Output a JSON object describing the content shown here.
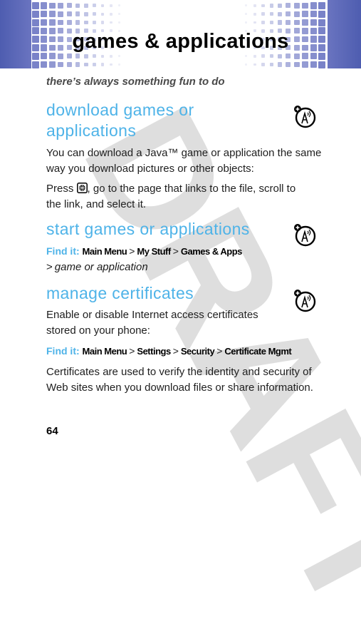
{
  "header": {
    "title": "games & applications"
  },
  "tagline": "there’s always something fun to do",
  "watermark": "DRAFT",
  "sections": [
    {
      "title_line1": "download games or",
      "title_line2": "applications",
      "icon": "network-feature-icon",
      "paragraph1": "You can download a Java™ game or application the same way you download pictures or other objects:",
      "paragraph1_line1": "You can download a Java™ game or application the same",
      "paragraph1_line2": "way you download pictures or other objects:",
      "press_prefix": "Press",
      "press_key_icon": "browser-key-icon",
      "press_line1_rest": ", go to the page that links to the file, scroll to",
      "press_line2": "the link, and select it."
    },
    {
      "title": "start games or applications",
      "icon": "network-feature-icon",
      "find_it_label": "Find it:",
      "path": [
        "Main Menu",
        "My Stuff",
        "Games & Apps"
      ],
      "path_tail": "game or application",
      "separator": ">"
    },
    {
      "title": "manage certificates",
      "icon": "network-feature-icon",
      "paragraph_line1": "Enable or disable Internet access certificates",
      "paragraph_line2": "stored on your phone:",
      "find_it_label": "Find it:",
      "path": [
        "Main Menu",
        "Settings",
        "Security",
        "Certificate Mgmt"
      ],
      "separator": ">",
      "note_line1": "Certificates are used to verify the identity and security of",
      "note_line2": "Web sites when you download files or share information."
    }
  ],
  "page_number": "64",
  "colors": {
    "accent": "#4eb3e8",
    "header_band": "#4e5db0",
    "watermark": "#dedede"
  }
}
